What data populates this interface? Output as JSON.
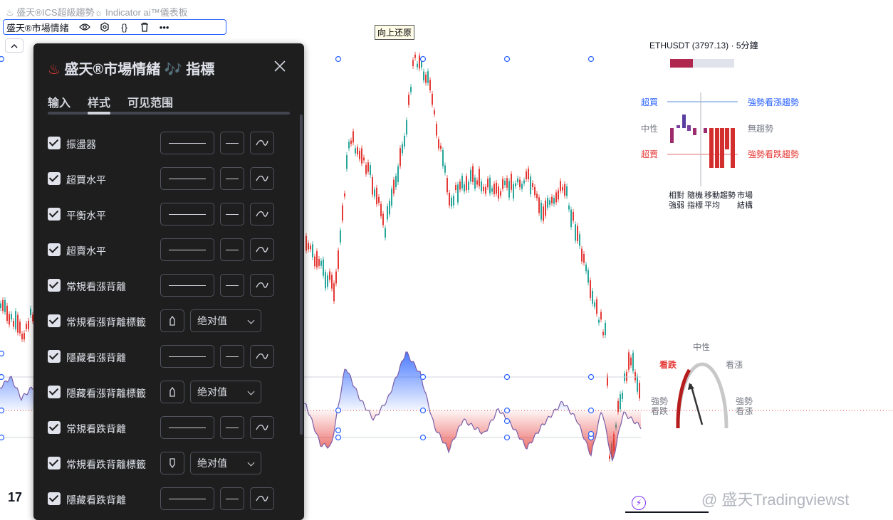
{
  "top_label": "♨ 盛天®ICS超級趨勢☼ Indicator ai™儀表板",
  "indicator_bar": {
    "name": "盛天®市場情緒",
    "eye_icon": "eye-icon",
    "gear_icon": "gear-icon",
    "code_label": "{}",
    "trash_icon": "trash-icon",
    "more_label": "•••"
  },
  "tooltip": "向上还原",
  "dialog": {
    "title": "盛天®市場情緒 🎶 指標",
    "tabs": [
      {
        "label": "输入"
      },
      {
        "label": "样式"
      },
      {
        "label": "可见范围"
      }
    ],
    "active_tab": "样式",
    "rows": [
      {
        "label": "振盪器",
        "type": "line"
      },
      {
        "label": "超買水平",
        "type": "line"
      },
      {
        "label": "平衡水平",
        "type": "line"
      },
      {
        "label": "超賣水平",
        "type": "line"
      },
      {
        "label": "常規看漲背離",
        "type": "line"
      },
      {
        "label": "常規看漲背離標籤",
        "type": "shape",
        "select": "绝对值"
      },
      {
        "label": "隱藏看漲背離",
        "type": "line"
      },
      {
        "label": "隱藏看漲背離標籤",
        "type": "shape",
        "select": "绝对值"
      },
      {
        "label": "常規看跌背離",
        "type": "line"
      },
      {
        "label": "常規看跌背離標籤",
        "type": "shape",
        "select": "绝对值"
      },
      {
        "label": "隱藏看跌背離",
        "type": "line"
      }
    ]
  },
  "symbol_title": "ETHUSDT (3797.13) · 5分鐘",
  "sentiment_panel": {
    "overbought": "超買",
    "neutral": "中性",
    "oversold": "超賣",
    "strong_up": "強勢看漲趨勢",
    "no_trend": "無趨勢",
    "strong_down": "強勢看跌趨勢",
    "col_labels": [
      "相對強弱",
      "隨機指標",
      "移動平均",
      "趨勢",
      "市場結構"
    ]
  },
  "gauge": {
    "neutral": "中性",
    "bearish": "看跌",
    "bullish": "看漲",
    "strong_bearish": "強勢看跌",
    "strong_bullish": "強勢看漲"
  },
  "watermark": "@ 盛天Tradingviewst",
  "tv_logo": "17",
  "colors": {
    "accent": "#2962ff",
    "bull": "#26a69a",
    "bear": "#e53935",
    "dialog_bg": "#1e1e1e"
  }
}
